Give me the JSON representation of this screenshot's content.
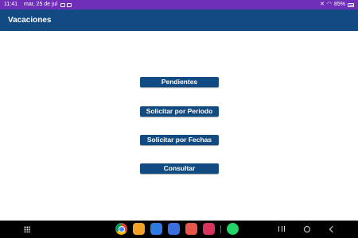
{
  "status_bar": {
    "time": "11:41",
    "date": "mar, 25 de jul",
    "battery": "85%"
  },
  "app_bar": {
    "title": "Vacaciones"
  },
  "menu": {
    "items": [
      {
        "label": "Pendientes"
      },
      {
        "label": "Solicitar por Periodo"
      },
      {
        "label": "Solicitar por Fechas"
      },
      {
        "label": "Consultar"
      }
    ]
  },
  "nav_bar": {
    "apps": [
      "chrome-icon",
      "files-icon",
      "calendar-icon",
      "messages-icon",
      "contacts-icon",
      "screen-recorder-icon",
      "whatsapp-icon"
    ]
  },
  "colors": {
    "primary": "#124a82",
    "status_bar": "#6f2fb8",
    "nav_bar": "#000000"
  }
}
